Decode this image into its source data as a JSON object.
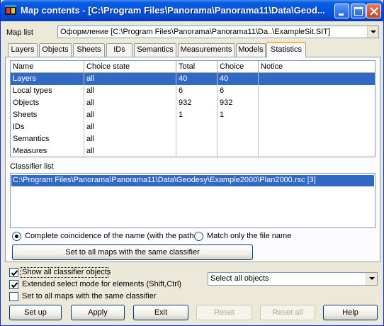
{
  "window": {
    "title": "Map contents - [C:\\Program Files\\Panorama\\Panorama11\\Data\\Geod..."
  },
  "map_list": {
    "label": "Map list",
    "value": "Оформление [C:\\Program Files\\Panorama\\Panorama11\\Da..\\ExampleSit.SIT]"
  },
  "tabs": [
    "Layers",
    "Objects",
    "Sheets",
    "IDs",
    "Semantics",
    "Measurements",
    "Models",
    "Statistics"
  ],
  "active_tab": "Statistics",
  "table": {
    "columns": [
      "Name",
      "Choice state",
      "Total",
      "Choice",
      "Notice"
    ],
    "rows": [
      {
        "name": "Layers",
        "state": "all",
        "total": "40",
        "choice": "40",
        "notice": ""
      },
      {
        "name": "Local types",
        "state": "all",
        "total": "6",
        "choice": "6",
        "notice": ""
      },
      {
        "name": "Objects",
        "state": "all",
        "total": "932",
        "choice": "932",
        "notice": ""
      },
      {
        "name": "Sheets",
        "state": "all",
        "total": "1",
        "choice": "1",
        "notice": ""
      },
      {
        "name": "IDs",
        "state": "all",
        "total": "",
        "choice": "",
        "notice": ""
      },
      {
        "name": "Semantics",
        "state": "all",
        "total": "",
        "choice": "",
        "notice": ""
      },
      {
        "name": "Measures",
        "state": "all",
        "total": "",
        "choice": "",
        "notice": ""
      }
    ],
    "selected_row": 0
  },
  "classifier": {
    "label": "Classifier list",
    "items": [
      "C:\\Program Files\\Panorama\\Panorama11\\Data\\Geodesy\\Example2000\\Plan2000.rsc [3]"
    ]
  },
  "match_options": {
    "complete": "Complete coincidence of the name (with the path",
    "file_only": "Match only the file name",
    "selected": "complete"
  },
  "set_same_classifier_button": "Set to all maps with the same classifier",
  "checkboxes": {
    "show_all": {
      "label": "Show all classifier objects",
      "checked": true
    },
    "extended": {
      "label": "Extended select mode for elements (Shift,Ctrl)",
      "checked": true
    },
    "set_all": {
      "label": "Set to all maps with the same classifier",
      "checked": false
    }
  },
  "select_objects": {
    "value": "Select all objects"
  },
  "buttons": {
    "setup": "Set up",
    "apply": "Apply",
    "exit": "Exit",
    "reset": "Reset",
    "reset_all": "Reset all",
    "help": "Help"
  },
  "colors": {
    "title_blue": "#0054e3",
    "selection": "#316ac5",
    "tab_highlight": "#f7b533",
    "face": "#ece9d8"
  },
  "icons": [
    "app-icon",
    "minimize-icon",
    "maximize-icon",
    "close-icon",
    "chevron-down-icon",
    "checkmark-icon"
  ]
}
